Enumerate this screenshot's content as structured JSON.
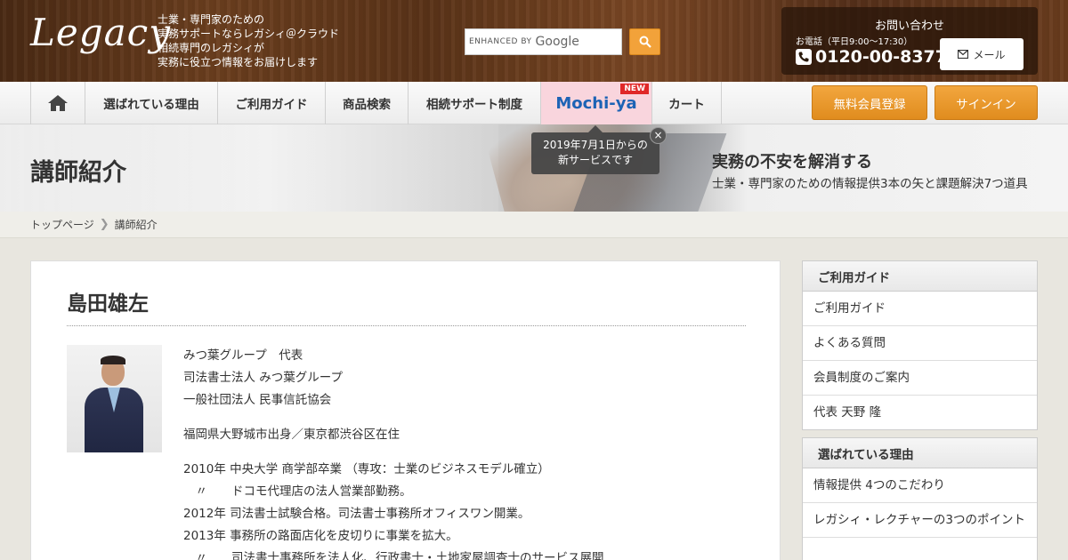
{
  "header": {
    "logo": "Legacy",
    "tagline": [
      "士業・専門家のための",
      "実務サポートならレガシィ＠クラウド",
      "相続専門のレガシィが",
      "実務に役立つ情報をお届けします"
    ],
    "search": {
      "enhanced_by": "ENHANCED BY",
      "google": "Google"
    },
    "contact": {
      "title": "お問い合わせ",
      "hours": "お電話（平日9:00～17:30）",
      "phone": "0120-00-8377",
      "mail_label": "メール"
    }
  },
  "nav": {
    "items": [
      "選ばれている理由",
      "ご利用ガイド",
      "商品検索",
      "相続サポート制度",
      "Mochi-ya",
      "カート"
    ],
    "new_badge": "NEW",
    "register": "無料会員登録",
    "signin": "サインイン"
  },
  "tooltip": {
    "line1": "2019年7月1日からの",
    "line2": "新サービスです",
    "close": "×"
  },
  "hero": {
    "title": "講師紹介",
    "catch": "実務の不安を解消する",
    "sub": "士業・専門家のための情報提供3本の矢と課題解決7つ道具"
  },
  "breadcrumb": {
    "home": "トップページ",
    "current": "講師紹介"
  },
  "article": {
    "name": "島田雄左",
    "roles": [
      "みつ葉グループ　代表",
      "司法書士法人 みつ葉グループ",
      "一般社団法人 民事信託協会"
    ],
    "origin": "福岡県大野城市出身／東京都渋谷区在住",
    "history": [
      "2010年 中央大学 商学部卒業 （専攻：士業のビジネスモデル確立）",
      "　〃　　ドコモ代理店の法人営業部勤務。",
      "2012年 司法書士試験合格。司法書士事務所オフィスワン開業。",
      "2013年 事務所の路面店化を皮切りに事業を拡大。",
      "　〃　　司法書士事務所を法人化、行政書士・土地家屋調査士のサービス展開"
    ]
  },
  "sidebar": {
    "guide": {
      "title": "ご利用ガイド",
      "items": [
        "ご利用ガイド",
        "よくある質問",
        "会員制度のご案内",
        "代表 天野 隆"
      ]
    },
    "reasons": {
      "title": "選ばれている理由",
      "items": [
        "情報提供 4つのこだわり",
        "レガシィ・レクチャーの3つのポイント",
        ""
      ]
    }
  },
  "colors": {
    "accent_orange": "#f2a23a",
    "mochi_blue": "#1d63b5",
    "new_red": "#e02828",
    "header_wood": "#5a3318"
  }
}
